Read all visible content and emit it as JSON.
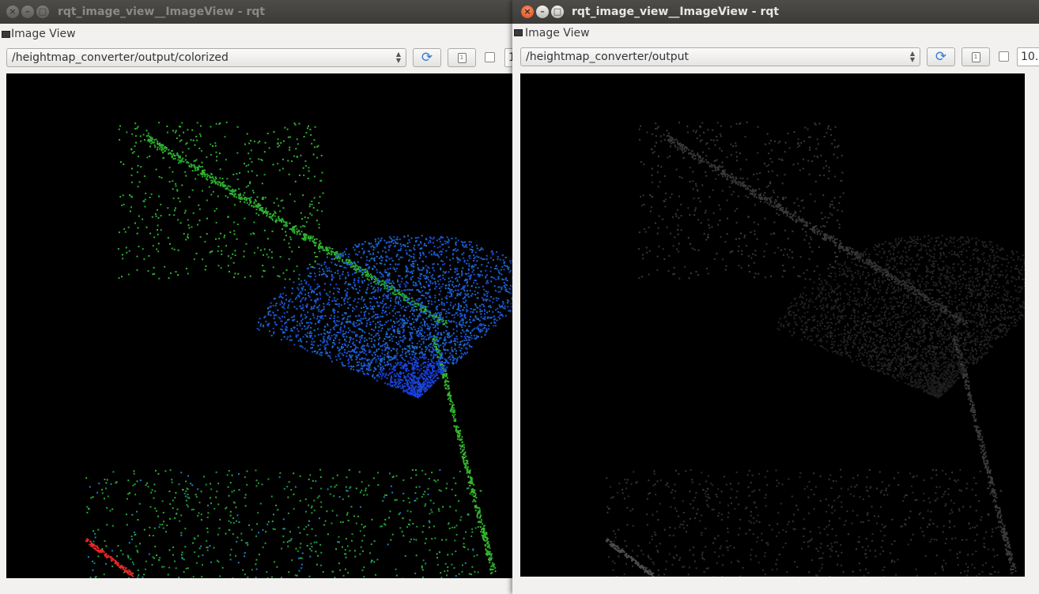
{
  "windows": [
    {
      "id": "left",
      "title": "rqt_image_view__ImageView - rqt",
      "menu_title": "Image View",
      "topic": "/heightmap_converter/output/colorized",
      "refresh_icon": "refresh-icon",
      "zoom_icon": "fit-zoom-icon",
      "zoom_value": "1",
      "focused": false,
      "image_style": "colorized"
    },
    {
      "id": "right",
      "title": "rqt_image_view__ImageView - rqt",
      "menu_title": "Image View",
      "topic": "/heightmap_converter/output",
      "refresh_icon": "refresh-icon",
      "zoom_icon": "fit-zoom-icon",
      "zoom_value": "10.",
      "focused": true,
      "image_style": "grayscale"
    }
  ],
  "colors": {
    "title_bar": "#3c3b37",
    "close_button_active": "#df4a16",
    "image_background": "#000000",
    "colorized_low": "#1e32e6",
    "colorized_mid": "#1fb437",
    "colorized_high": "#cc3322",
    "grayscale_points": "#4a4a4a"
  }
}
